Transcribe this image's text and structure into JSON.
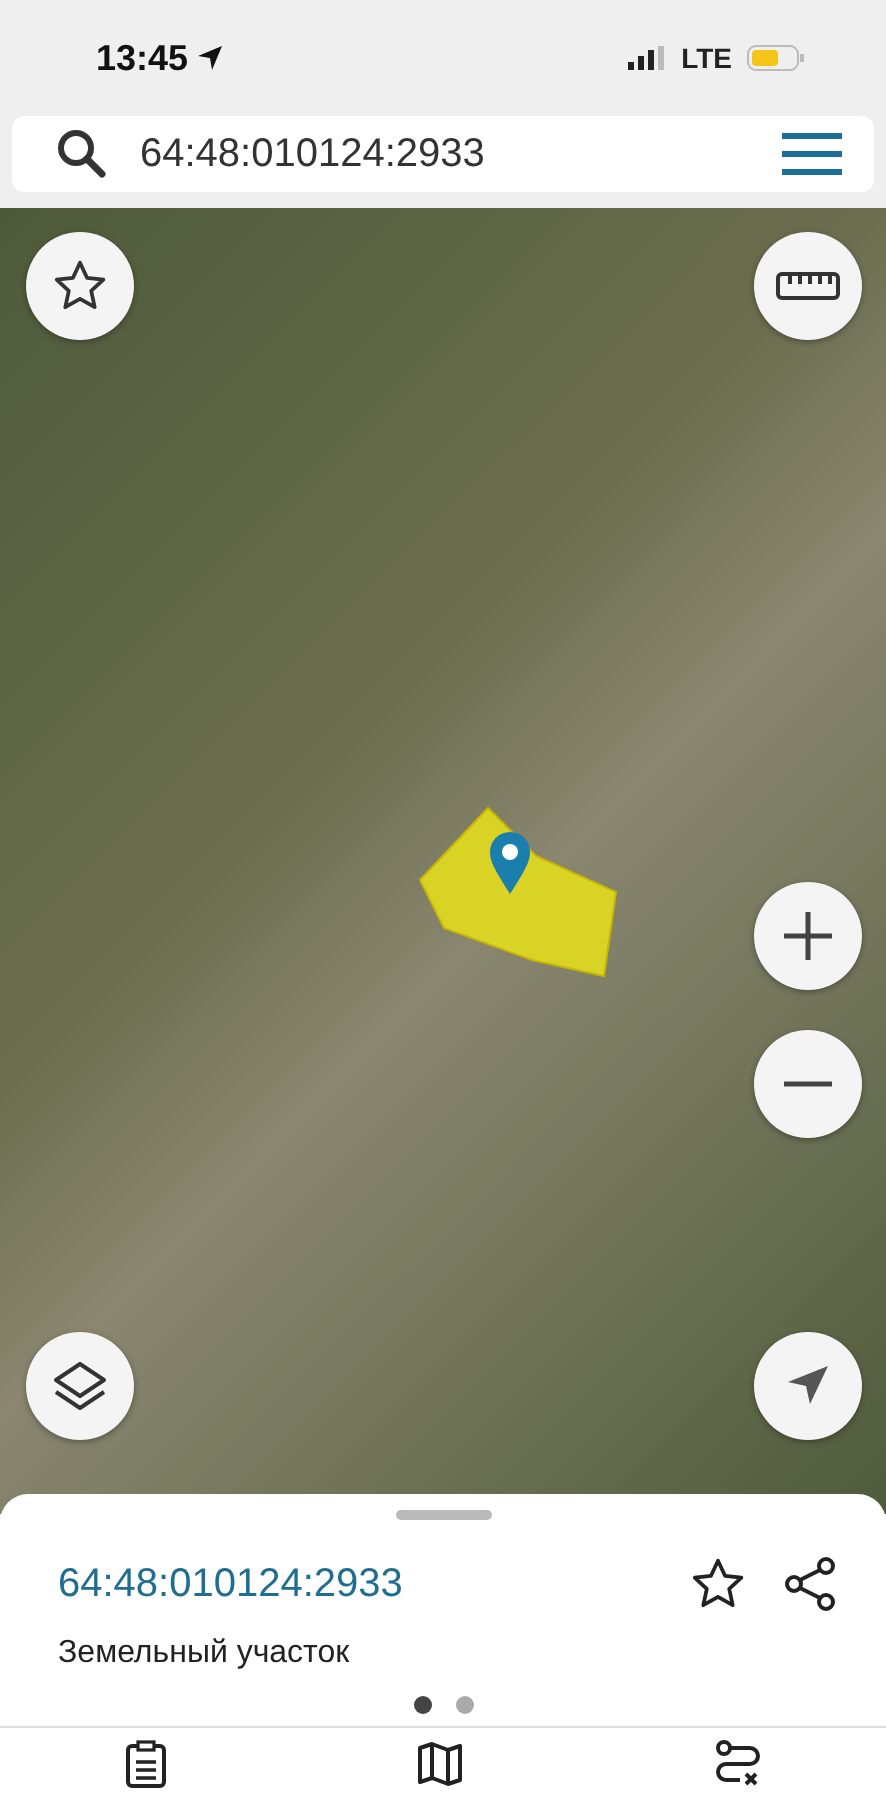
{
  "status_bar": {
    "time": "13:45",
    "network": "LTE"
  },
  "search": {
    "value": "64:48:010124:2933"
  },
  "sheet": {
    "title": "64:48:010124:2933",
    "subtitle": "Земельный участок",
    "pages": [
      {
        "selected": true
      },
      {
        "selected": false
      }
    ]
  }
}
